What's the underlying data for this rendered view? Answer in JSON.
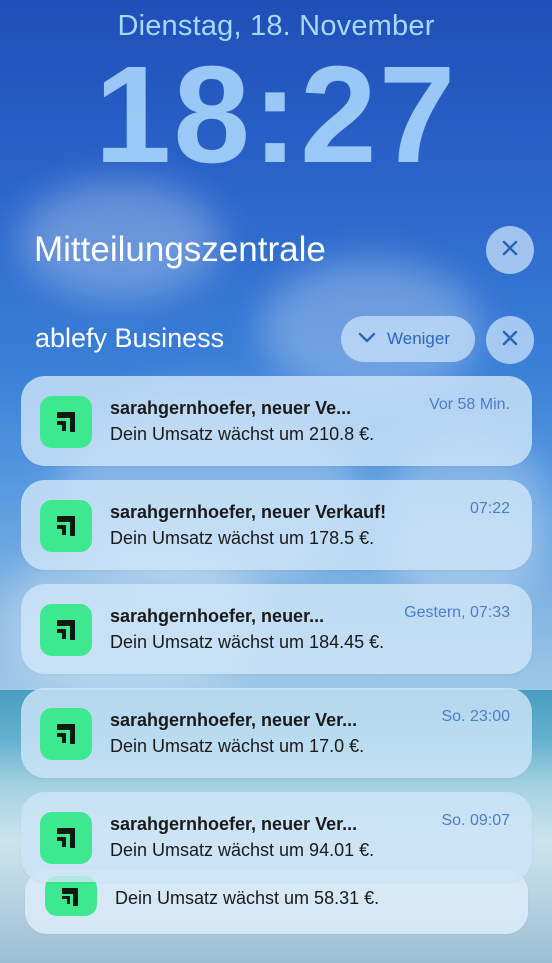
{
  "lockscreen": {
    "date": "Dienstag, 18. November",
    "time": "18:27"
  },
  "notification_center": {
    "title": "Mitteilungszentrale",
    "clear_icon": "close-icon"
  },
  "group": {
    "app_name": "ablefy Business",
    "collapse_label": "Weniger",
    "collapse_icon": "chevron-down-icon",
    "clear_icon": "close-icon"
  },
  "notifications": [
    {
      "title": "sarahgernhoefer, neuer Ve...",
      "body": "Dein Umsatz wächst um 210.8 €.",
      "time": "Vor 58 Min."
    },
    {
      "title": "sarahgernhoefer, neuer Verkauf!",
      "body": "Dein Umsatz wächst um 178.5 €.",
      "time": "07:22"
    },
    {
      "title": "sarahgernhoefer, neuer...",
      "body": "Dein Umsatz wächst um 184.45 €.",
      "time": "Gestern, 07:33"
    },
    {
      "title": "sarahgernhoefer, neuer Ver...",
      "body": "Dein Umsatz wächst um 17.0 €.",
      "time": "So. 23:00"
    },
    {
      "title": "sarahgernhoefer, neuer Ver...",
      "body": "Dein Umsatz wächst um 94.01 €.",
      "time": "So. 09:07"
    },
    {
      "body": "Dein Umsatz wächst um 58.31 €."
    }
  ],
  "colors": {
    "app_icon_bg": "#3ee890",
    "time_text": "#4b7ec9",
    "button_bg": "#c8e1fa"
  }
}
